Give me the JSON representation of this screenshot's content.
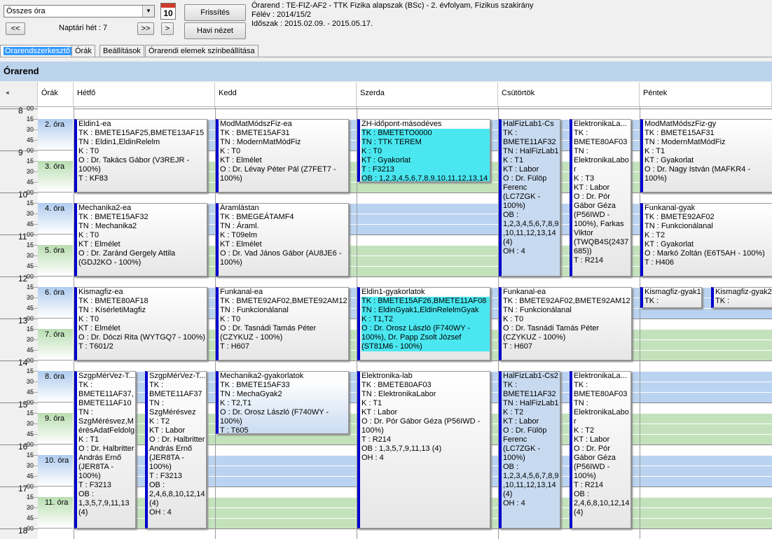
{
  "toolbar": {
    "dropdown_value": "Összes óra",
    "prev_label": "<<",
    "week_label": "Naptári hét : 7",
    "next_label": ">>",
    "next_small_label": ">",
    "calendar_number": "10",
    "refresh_label": "Frissítés",
    "monthly_label": "Havi nézet"
  },
  "info": {
    "line1": "Órarend : TE-FIZ-AF2 - TTK Fizika alapszak (BSc) - 2. évfolyam, Fizikus szakirány",
    "line2": "Félév : 2014/15/2",
    "line3": "Időszak : 2015.02.09. - 2015.05.17."
  },
  "tabs": [
    "Órarendszerkesztő",
    "Órák",
    "Beállítások",
    "Órarendi elemek színbeállítása"
  ],
  "title": "Órarend",
  "headers": {
    "orak": "Órák",
    "days": [
      "Hétfő",
      "Kedd",
      "Szerda",
      "Csütörtök",
      "Péntek"
    ]
  },
  "hours": [
    "8",
    "9",
    "10",
    "11",
    "12",
    "13",
    "14",
    "15",
    "16",
    "17",
    "18"
  ],
  "minutes": [
    "00",
    "15",
    "30",
    "45"
  ],
  "ora_labels": [
    "2. óra",
    "3. óra",
    "4. óra",
    "5. óra",
    "6. óra",
    "7. óra",
    "8. óra",
    "9. óra",
    "10. óra",
    "11. óra"
  ],
  "events": [
    {
      "title": "Eldin1-ea",
      "body": "TK : BMETE15AF25,BMETE13AF15\nTN : Eldin1,EldinRelelm\nK : T0\nO : Dr. Takács Gábor (V3REJR - 100%)\nT : KF83"
    },
    {
      "title": "Mechanika2-ea",
      "body": "TK : BMETE15AF32\nTN : Mechanika2\nK : T0\nKT : Elmélet\nO : Dr. Zaránd Gergely Attila (GDJ2KO - 100%)"
    },
    {
      "title": "Kismagfiz-ea",
      "body": "TK : BMETE80AF18\nTN : KísérletiMagfiz\nK : T0\nKT : Elmélet\nO : Dr. Dóczi Rita (WYTGQ7 - 100%)\nT : T601/2"
    },
    {
      "title": "SzgpMérVez-T...",
      "body": "TK :\nBMETE11AF37,\nBMETE11AF10\nTN :\nSzgMérésvez,M\nérésAdatFeldolg\nK : T1\nO : Dr. Halbritter\nAndrás Ernő\n(JER8TA -\n100%)\nT : F3213\nOB :\n1,3,5,7,9,11,13\n(4)"
    },
    {
      "title": "SzgpMérVez-T...",
      "body": "TK :\nBMETE11AF37\nTN :\nSzgMérésvez\nK : T2\nKT : Labor\nO : Dr. Halbritter\nAndrás Ernő\n(JER8TA -\n100%)\nT : F3213\nOB :\n2,4,6,8,10,12,14\n(4)\nOH : 4"
    },
    {
      "title": "ModMatMódszFiz-ea",
      "body": "TK : BMETE15AF31\nTN : ModernMatMódFiz\nK : T0\nKT : Elmélet\nO : Dr. Lévay Péter Pál (Z7FET7 - 100%)"
    },
    {
      "title": "Áramlástan",
      "body": "TK : BMEGEÁTAMF4\nTN : Áraml.\nK : T09elm\nKT : Elmélet\nO : Dr. Vad János Gábor (AU8JE6 - 100%)"
    },
    {
      "title": "Funkanal-ea",
      "body": "TK : BMETE92AF02,BMETE92AM12\nTN : Funkcionálanal\nK : T0\nO : Dr. Tasnádi Tamás Péter (CZYKUZ - 100%)\nT : H607"
    },
    {
      "title": "Mechanika2-gyakorlatok",
      "body": "TK : BMETE15AF33\nTN : MechaGyak2\nK : T2,T1\nO : Dr. Orosz László (F740WY - 100%)\nT : T605"
    },
    {
      "title": "ZH-időpont-másodéves",
      "body": "TK : BMETETO0000\nTN : TTK TEREM\nK : T0\nKT : Gyakorlat\nT : F3213\nOB : 1,2,3,4,5,6,7,8,9,10,11,12,13,14"
    },
    {
      "title": "Eldin1-gyakorlatok",
      "body": "TK : BMETE15AF26,BMETE11AF08\nTN : EldinGyak1,EldinRelelmGyak\nK : T1,T2\nO : Dr. Orosz László (F740WY - 100%), Dr. Papp Zsolt József (ST81M6 - 100%)"
    },
    {
      "title": "Elektronika-lab",
      "body": "TK : BMETE80AF03\nTN : ElektronikaLabor\nK : T1\nKT : Labor\nO : Dr. Pór Gábor Géza (P56IWD - 100%)\nT : R214\nOB : 1,3,5,7,9,11,13 (4)\nOH : 4"
    },
    {
      "title": "HalFizLab1-Cs",
      "body": "TK :\nBMETE11AF32\nTN : HalFizLab1\nK : T1\nKT : Labor\nO : Dr. Fülöp\nFerenc\n(LC7ZGK -\n100%)\nOB :\n1,2,3,4,5,6,7,8,9\n,10,11,12,13,14\n(4)\nOH : 4"
    },
    {
      "title": "ElektronikaLa...",
      "body": "TK :\nBMETE80AF03\nTN :\nElektronikaLabo\nr\nK : T3\nKT : Labor\nO : Dr. Pór\nGábor Géza\n(P56IWD -\n100%), Farkas\nViktor\n(TWQB4S(2437\n685))\nT : R214"
    },
    {
      "title": "Funkanal-ea",
      "body": "TK : BMETE92AF02,BMETE92AM12\nTN : Funkcionálanal\nK : T0\nO : Dr. Tasnádi Tamás Péter (CZYKUZ - 100%)\nT : H607"
    },
    {
      "title": "HalFizLab1-Cs2",
      "body": "TK :\nBMETE11AF32\nTN : HalFizLab1\nK : T2\nKT : Labor\nO : Dr. Fülöp\nFerenc\n(LC7ZGK -\n100%)\nOB :\n1,2,3,4,5,6,7,8,9\n,10,11,12,13,14\n(4)\nOH : 4"
    },
    {
      "title": "ElektronikaLa...",
      "body": "TK :\nBMETE80AF03\nTN :\nElektronikaLabo\nr\nK : T2\nKT : Labor\nO : Dr. Pór\nGábor Géza\n(P56IWD -\n100%)\nT : R214\nOB :\n2,4,6,8,10,12,14\n(4)"
    },
    {
      "title": "ModMatMódszFiz-gy",
      "body": "TK : BMETE15AF31\nTN : ModernMatMódFiz\nK : T1\nKT : Gyakorlat\nO : Dr. Nagy István (MAFKR4 - 100%)"
    },
    {
      "title": "Funkanal-gyak",
      "body": "TK : BMETE92AF02\nTN : Funkcionálanal\nK : T2\nKT : Gyakorlat\nO : Markó Zoltán (E6T5AH - 100%)\nT : H406"
    },
    {
      "title": "Kismagfiz-gyak1",
      "body": "TK :"
    },
    {
      "title": "Kismagfiz-gyak2",
      "body": "TK :"
    }
  ]
}
